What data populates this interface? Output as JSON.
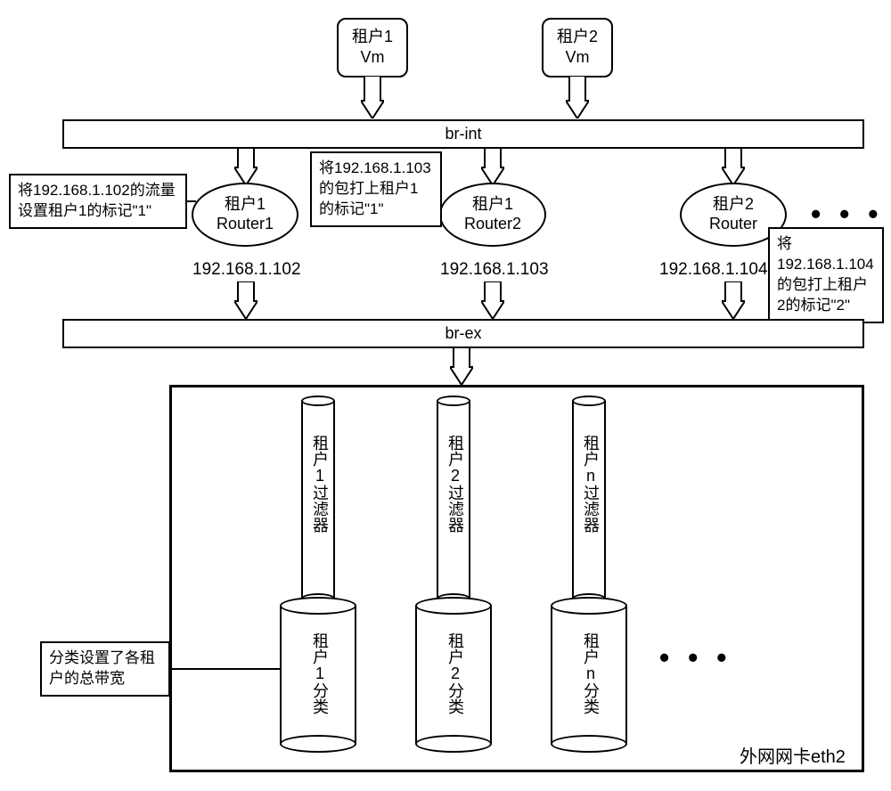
{
  "tenants": {
    "vm1": {
      "line1": "租户1",
      "line2": "Vm"
    },
    "vm2": {
      "line1": "租户2",
      "line2": "Vm"
    }
  },
  "bridges": {
    "int": "br-int",
    "ex": "br-ex"
  },
  "routers": {
    "r1": {
      "line1": "租户1",
      "line2": "Router1",
      "ip": "192.168.1.102"
    },
    "r2": {
      "line1": "租户1",
      "line2": "Router2",
      "ip": "192.168.1.103"
    },
    "r3": {
      "line1": "租户2",
      "line2": "Router",
      "ip": "192.168.1.104"
    }
  },
  "notes": {
    "n1": "将192.168.1.102的流量设置租户1的标记\"1\"",
    "n2": "将192.168.1.103的包打上租户1的标记\"1\"",
    "n3": "将192.168.1.104的包打上租户2的标记\"2\"",
    "n4": "分类设置了各租户的总带宽"
  },
  "nic_label": "外网网卡eth2",
  "filters": {
    "f1": "租户1过滤器",
    "f2": "租户2过滤器",
    "fn": "租户n过滤器"
  },
  "classes": {
    "c1": "租户1分类",
    "c2": "租户2分类",
    "cn": "租户n分类"
  },
  "ellipsis": "• • •"
}
